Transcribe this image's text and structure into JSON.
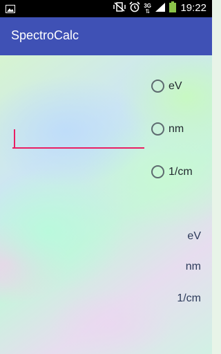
{
  "status_bar": {
    "time": "19:22",
    "network": "3G",
    "icons": [
      "image-icon",
      "vibrate-off-icon",
      "alarm-icon",
      "signal-3g-icon",
      "signal-bars-icon",
      "battery-icon"
    ]
  },
  "app_bar": {
    "title": "SpectroCalc",
    "color": "#3f51b5"
  },
  "input": {
    "value": "",
    "accent": "#e91e63"
  },
  "units": {
    "options": [
      {
        "label": "eV",
        "selected": false
      },
      {
        "label": "nm",
        "selected": false
      },
      {
        "label": "1/cm",
        "selected": false
      }
    ]
  },
  "results": [
    {
      "label": "eV"
    },
    {
      "label": "nm"
    },
    {
      "label": "1/cm"
    }
  ]
}
